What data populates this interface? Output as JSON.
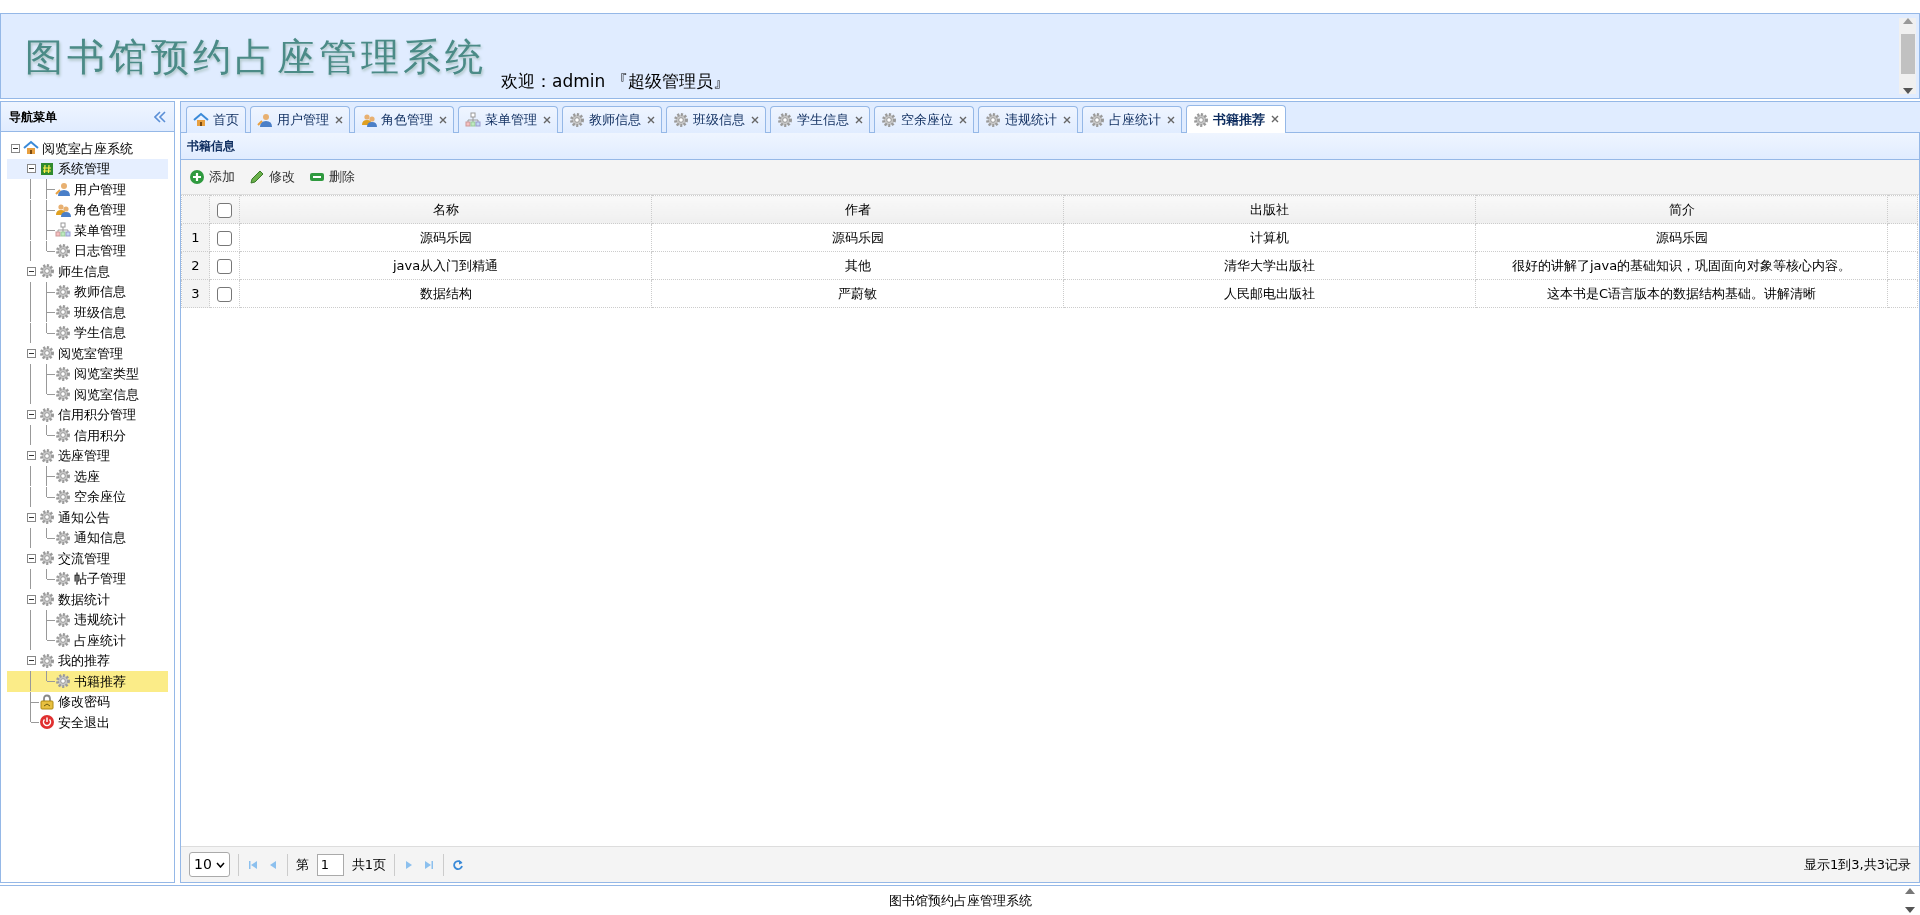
{
  "header": {
    "title": "图书馆预约占座管理系统",
    "welcome": "欢迎：admin 『超级管理员』"
  },
  "nav": {
    "title": "导航菜单",
    "tree": [
      {
        "label": "阅览室占座系统",
        "kind": "house",
        "expanded": true,
        "selected": false,
        "hovered": false,
        "children": [
          {
            "label": "系统管理",
            "kind": "hash",
            "expanded": true,
            "selected": false,
            "hovered": true,
            "children": [
              {
                "label": "用户管理",
                "kind": "user",
                "selected": false,
                "hovered": false
              },
              {
                "label": "角色管理",
                "kind": "users",
                "selected": false,
                "hovered": false
              },
              {
                "label": "菜单管理",
                "kind": "org",
                "selected": false,
                "hovered": false
              },
              {
                "label": "日志管理",
                "kind": "gear",
                "selected": false,
                "hovered": false
              }
            ]
          },
          {
            "label": "师生信息",
            "kind": "gear",
            "expanded": true,
            "selected": false,
            "hovered": false,
            "children": [
              {
                "label": "教师信息",
                "kind": "gear",
                "selected": false,
                "hovered": false
              },
              {
                "label": "班级信息",
                "kind": "gear",
                "selected": false,
                "hovered": false
              },
              {
                "label": "学生信息",
                "kind": "gear",
                "selected": false,
                "hovered": false
              }
            ]
          },
          {
            "label": "阅览室管理",
            "kind": "gear",
            "expanded": true,
            "selected": false,
            "hovered": false,
            "children": [
              {
                "label": "阅览室类型",
                "kind": "gear",
                "selected": false,
                "hovered": false
              },
              {
                "label": "阅览室信息",
                "kind": "gear",
                "selected": false,
                "hovered": false
              }
            ]
          },
          {
            "label": "信用积分管理",
            "kind": "gear",
            "expanded": true,
            "selected": false,
            "hovered": false,
            "children": [
              {
                "label": "信用积分",
                "kind": "gear",
                "selected": false,
                "hovered": false
              }
            ]
          },
          {
            "label": "选座管理",
            "kind": "gear",
            "expanded": true,
            "selected": false,
            "hovered": false,
            "children": [
              {
                "label": "选座",
                "kind": "gear",
                "selected": false,
                "hovered": false
              },
              {
                "label": "空余座位",
                "kind": "gear",
                "selected": false,
                "hovered": false
              }
            ]
          },
          {
            "label": "通知公告",
            "kind": "gear",
            "expanded": true,
            "selected": false,
            "hovered": false,
            "children": [
              {
                "label": "通知信息",
                "kind": "gear",
                "selected": false,
                "hovered": false
              }
            ]
          },
          {
            "label": "交流管理",
            "kind": "gear",
            "expanded": true,
            "selected": false,
            "hovered": false,
            "children": [
              {
                "label": "帖子管理",
                "kind": "gear",
                "selected": false,
                "hovered": false
              }
            ]
          },
          {
            "label": "数据统计",
            "kind": "gear",
            "expanded": true,
            "selected": false,
            "hovered": false,
            "children": [
              {
                "label": "违规统计",
                "kind": "gear",
                "selected": false,
                "hovered": false
              },
              {
                "label": "占座统计",
                "kind": "gear",
                "selected": false,
                "hovered": false
              }
            ]
          },
          {
            "label": "我的推荐",
            "kind": "gear",
            "expanded": true,
            "selected": false,
            "hovered": false,
            "children": [
              {
                "label": "书籍推荐",
                "kind": "gear",
                "selected": true,
                "hovered": false
              }
            ]
          },
          {
            "label": "修改密码",
            "kind": "lock",
            "selected": false,
            "hovered": false
          },
          {
            "label": "安全退出",
            "kind": "power",
            "selected": false,
            "hovered": false
          }
        ]
      }
    ]
  },
  "tabs": [
    {
      "label": "首页",
      "kind": "house",
      "closable": false,
      "selected": false
    },
    {
      "label": "用户管理",
      "kind": "user",
      "closable": true,
      "selected": false
    },
    {
      "label": "角色管理",
      "kind": "users",
      "closable": true,
      "selected": false
    },
    {
      "label": "菜单管理",
      "kind": "org",
      "closable": true,
      "selected": false
    },
    {
      "label": "教师信息",
      "kind": "gear",
      "closable": true,
      "selected": false
    },
    {
      "label": "班级信息",
      "kind": "gear",
      "closable": true,
      "selected": false
    },
    {
      "label": "学生信息",
      "kind": "gear",
      "closable": true,
      "selected": false
    },
    {
      "label": "空余座位",
      "kind": "gear",
      "closable": true,
      "selected": false
    },
    {
      "label": "违规统计",
      "kind": "gear",
      "closable": true,
      "selected": false
    },
    {
      "label": "占座统计",
      "kind": "gear",
      "closable": true,
      "selected": false
    },
    {
      "label": "书籍推荐",
      "kind": "gear",
      "closable": true,
      "selected": true
    }
  ],
  "panel": {
    "title": "书籍信息",
    "toolbar": [
      {
        "label": "添加",
        "kind": "add"
      },
      {
        "label": "修改",
        "kind": "edit"
      },
      {
        "label": "删除",
        "kind": "remove"
      }
    ],
    "table": {
      "columns": [
        "名称",
        "作者",
        "出版社",
        "简介"
      ],
      "header_checked": false,
      "rows": [
        {
          "number": "1",
          "checked": false,
          "cells": [
            "源码乐园",
            "源码乐园",
            "计算机",
            "源码乐园"
          ]
        },
        {
          "number": "2",
          "checked": false,
          "cells": [
            "java从入门到精通",
            "其他",
            "清华大学出版社",
            "很好的讲解了java的基础知识，巩固面向对象等核心内容。"
          ]
        },
        {
          "number": "3",
          "checked": false,
          "cells": [
            "数据结构",
            "严蔚敏",
            "人民邮电出版社",
            "这本书是C语言版本的数据结构基础。讲解清晰"
          ]
        }
      ]
    },
    "pagination": {
      "page_size": "10",
      "page_prefix": "第",
      "page": "1",
      "total_pages": "共1页",
      "summary": "显示1到3,共3记录"
    }
  },
  "footer": "图书馆预约占座管理系统"
}
